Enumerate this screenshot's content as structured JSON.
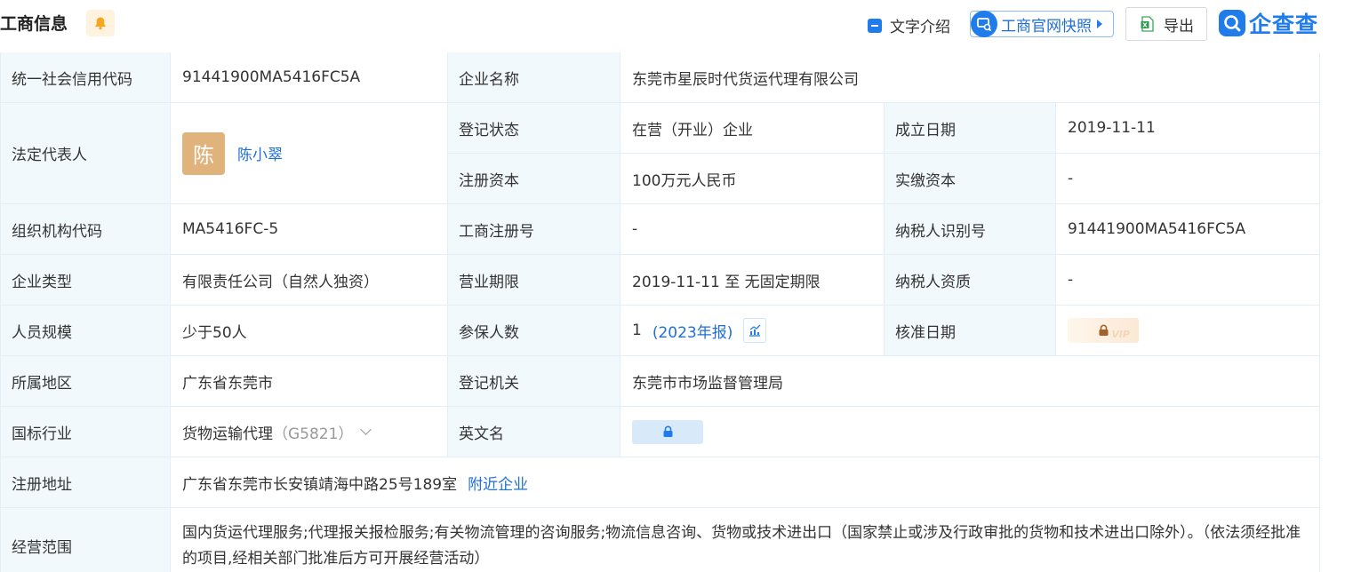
{
  "header": {
    "title": "工商信息",
    "text_intro": "文字介绍",
    "snapshot": "工商官网快照",
    "export": "导出",
    "logo": "企查查"
  },
  "rows": {
    "credit_code": {
      "label": "统一社会信用代码",
      "value": "91441900MA5416FC5A"
    },
    "company_name": {
      "label": "企业名称",
      "value": "东莞市星辰时代货运代理有限公司"
    },
    "legal_rep": {
      "label": "法定代表人",
      "avatar": "陈",
      "name": "陈小翠"
    },
    "reg_status": {
      "label": "登记状态",
      "value": "在营（开业）企业"
    },
    "found_date": {
      "label": "成立日期",
      "value": "2019-11-11"
    },
    "reg_capital": {
      "label": "注册资本",
      "value": "100万元人民币"
    },
    "paid_capital": {
      "label": "实缴资本",
      "value": "-"
    },
    "org_code": {
      "label": "组织机构代码",
      "value": "MA5416FC-5"
    },
    "reg_no": {
      "label": "工商注册号",
      "value": "-"
    },
    "tax_id": {
      "label": "纳税人识别号",
      "value": "91441900MA5416FC5A"
    },
    "company_type": {
      "label": "企业类型",
      "value": "有限责任公司（自然人独资）"
    },
    "biz_term": {
      "label": "营业期限",
      "value": "2019-11-11 至 无固定期限"
    },
    "taxpayer_qual": {
      "label": "纳税人资质",
      "value": "-"
    },
    "staff_size": {
      "label": "人员规模",
      "value": "少于50人"
    },
    "insured": {
      "label": "参保人数",
      "value": "1",
      "report": "(2023年报)"
    },
    "approve_date": {
      "label": "核准日期"
    },
    "region": {
      "label": "所属地区",
      "value": "广东省东莞市"
    },
    "reg_authority": {
      "label": "登记机关",
      "value": "东莞市市场监督管理局"
    },
    "industry": {
      "label": "国标行业",
      "value": "货物运输代理",
      "code": "（G5821）"
    },
    "english_name": {
      "label": "英文名"
    },
    "reg_address": {
      "label": "注册地址",
      "value": "广东省东莞市长安镇靖海中路25号189室",
      "nearby": "附近企业"
    },
    "biz_scope": {
      "label": "经营范围",
      "value": "国内货运代理服务;代理报关报检服务;有关物流管理的咨询服务;物流信息咨询、货物或技术进出口（国家禁止或涉及行政审批的货物和技术进出口除外）。（依法须经批准的项目,经相关部门批准后方可开展经营活动）"
    }
  },
  "icons": {
    "bell": "bell-icon",
    "doc": "document-icon",
    "snapshot": "snapshot-icon",
    "excel": "excel-icon",
    "chart": "trend-chart-icon",
    "lock": "lock-icon",
    "chevron": "chevron-down-icon"
  },
  "colors": {
    "accent": "#1f7cea",
    "label_bg": "#f2f9fc",
    "border": "#e4eef6",
    "avatar": "#e0b27c"
  }
}
